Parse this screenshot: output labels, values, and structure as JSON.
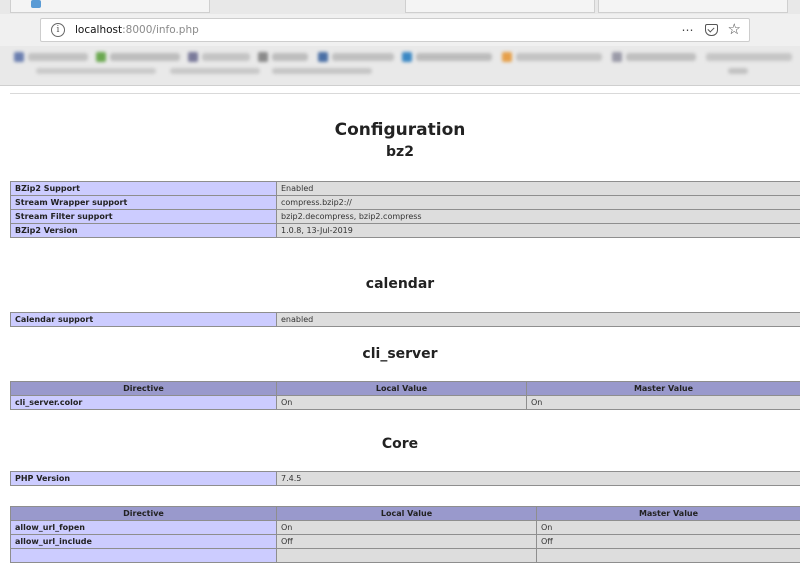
{
  "browser": {
    "url_host": "localhost",
    "url_rest": ":8000/info.php"
  },
  "page": {
    "title": "Configuration",
    "modules": [
      {
        "name": "bz2",
        "rows": [
          [
            "BZip2 Support",
            "Enabled"
          ],
          [
            "Stream Wrapper support",
            "compress.bzip2://"
          ],
          [
            "Stream Filter support",
            "bzip2.decompress, bzip2.compress"
          ],
          [
            "BZip2 Version",
            "1.0.8, 13-Jul-2019"
          ]
        ]
      },
      {
        "name": "calendar",
        "rows": [
          [
            "Calendar support",
            "enabled"
          ]
        ]
      },
      {
        "name": "cli_server",
        "directive_headers": [
          "Directive",
          "Local Value",
          "Master Value"
        ],
        "directives": [
          [
            "cli_server.color",
            "On",
            "On"
          ]
        ]
      },
      {
        "name": "Core",
        "rows": [
          [
            "PHP Version",
            "7.4.5"
          ]
        ],
        "directive_headers": [
          "Directive",
          "Local Value",
          "Master Value"
        ],
        "directives": [
          [
            "allow_url_fopen",
            "On",
            "On"
          ],
          [
            "allow_url_include",
            "Off",
            "Off"
          ]
        ]
      }
    ]
  }
}
